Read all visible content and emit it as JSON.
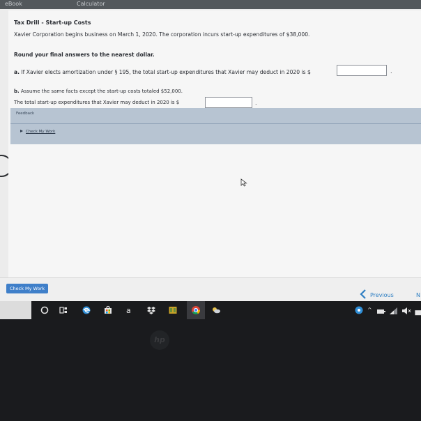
{
  "topbar": {
    "tab1": "eBook",
    "tab2": "Calculator"
  },
  "problem": {
    "title": "Tax Drill - Start-up Costs",
    "intro": "Xavier Corporation begins business on March 1, 2020. The corporation incurs start-up expenditures of $38,000.",
    "instruction": "Round your final answers to the nearest dollar.",
    "part_a": {
      "marker": "a.",
      "text": "If Xavier elects amortization under § 195, the total start-up expenditures that Xavier may deduct in 2020 is $",
      "value": "",
      "after": "."
    },
    "part_b": {
      "marker": "b.",
      "text": "Assume the same facts except the start-up costs totaled $52,000.",
      "line2": "The total start-up expenditures that Xavier may deduct in 2020 is $",
      "value": "",
      "after": "."
    }
  },
  "feedback": {
    "title": "Feedback",
    "link": "Check My Work"
  },
  "footer": {
    "check_button": "Check My Work",
    "previous": "Previous",
    "next": "N"
  },
  "taskbar": {
    "icons": [
      "cortana-circle-icon",
      "task-view-icon",
      "edge-icon",
      "store-icon",
      "amazon-icon",
      "dropbox-icon",
      "app-tile-icon",
      "chrome-icon",
      "weather-icon"
    ],
    "amazon_glyph": "a"
  },
  "laptop": {
    "brand": "hp"
  }
}
